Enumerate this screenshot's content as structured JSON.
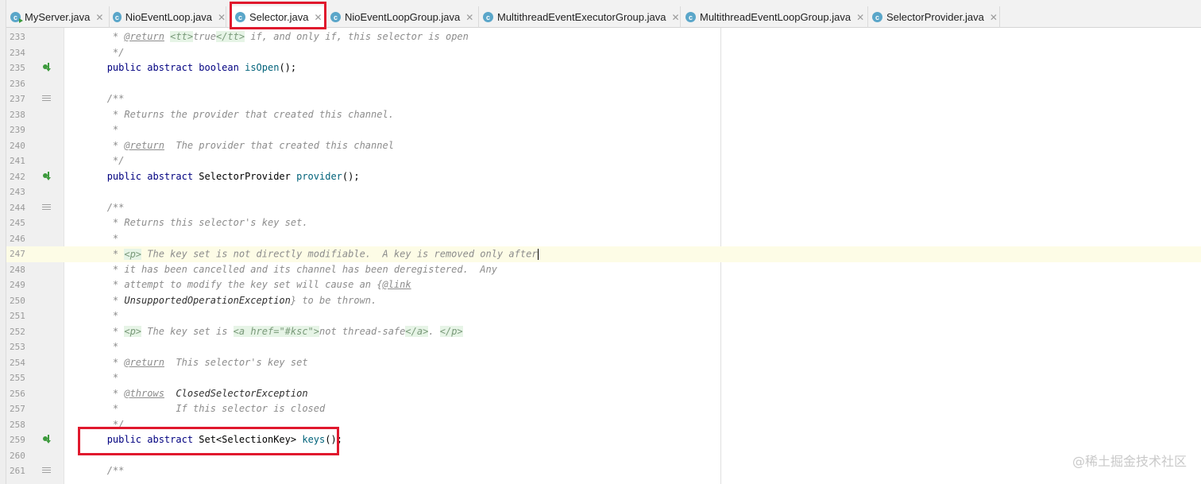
{
  "tabs": [
    {
      "label": "MyServer.java",
      "icon": "class-icon-runnable",
      "active": false
    },
    {
      "label": "NioEventLoop.java",
      "icon": "class-icon",
      "active": false
    },
    {
      "label": "Selector.java",
      "icon": "class-icon",
      "active": true
    },
    {
      "label": "NioEventLoopGroup.java",
      "icon": "class-icon",
      "active": false
    },
    {
      "label": "MultithreadEventExecutorGroup.java",
      "icon": "class-icon",
      "active": false
    },
    {
      "label": "MultithreadEventLoopGroup.java",
      "icon": "class-icon",
      "active": false
    },
    {
      "label": "SelectorProvider.java",
      "icon": "class-icon",
      "active": false
    }
  ],
  "tab_close_glyph": "✕",
  "editor": {
    "current_line": "247",
    "lines": [
      {
        "num": "233",
        "marker": "",
        "html": "    <span class=\"cm\">* <span class=\"tag\">@return</span> <span class=\"ht\">&lt;tt&gt;</span>true<span class=\"ht\">&lt;/tt&gt;</span> if, and only if, this selector is open</span>"
      },
      {
        "num": "234",
        "marker": "",
        "html": "    <span class=\"cm\">*/</span>"
      },
      {
        "num": "235",
        "marker": "impl",
        "html": "   <span class=\"kw\">public abstract boolean</span> <span class=\"m\">isOpen</span>();"
      },
      {
        "num": "236",
        "marker": "",
        "html": ""
      },
      {
        "num": "237",
        "marker": "doc",
        "html": "   <span class=\"cm\">/**</span>"
      },
      {
        "num": "238",
        "marker": "",
        "html": "    <span class=\"cm\">* Returns the provider that created this channel.</span>"
      },
      {
        "num": "239",
        "marker": "",
        "html": "    <span class=\"cm\">*</span>"
      },
      {
        "num": "240",
        "marker": "",
        "html": "    <span class=\"cm\">* <span class=\"tag\">@return</span>  The provider that created this channel</span>"
      },
      {
        "num": "241",
        "marker": "",
        "html": "    <span class=\"cm\">*/</span>"
      },
      {
        "num": "242",
        "marker": "impl",
        "html": "   <span class=\"kw\">public abstract</span> SelectorProvider <span class=\"m\">provider</span>();"
      },
      {
        "num": "243",
        "marker": "",
        "html": ""
      },
      {
        "num": "244",
        "marker": "doc",
        "html": "   <span class=\"cm\">/**</span>"
      },
      {
        "num": "245",
        "marker": "",
        "html": "    <span class=\"cm\">* Returns this selector's key set.</span>"
      },
      {
        "num": "246",
        "marker": "",
        "html": "    <span class=\"cm\">*</span>"
      },
      {
        "num": "247",
        "marker": "",
        "html": "    <span class=\"cm\">* <span class=\"ht\">&lt;p&gt;</span> The key set is not directly modifiable.  A key is removed only after</span><span class=\"caret\"></span>"
      },
      {
        "num": "248",
        "marker": "",
        "html": "    <span class=\"cm\">* it has been cancelled and its channel has been deregistered.  Any</span>"
      },
      {
        "num": "249",
        "marker": "",
        "html": "    <span class=\"cm\">* attempt to modify the key set will cause an {<span class=\"tag\">@link</span></span>"
      },
      {
        "num": "250",
        "marker": "",
        "html": "    <span class=\"cm\">* <span class=\"ref\">UnsupportedOperationException</span>} to be thrown.</span>"
      },
      {
        "num": "251",
        "marker": "",
        "html": "    <span class=\"cm\">*</span>"
      },
      {
        "num": "252",
        "marker": "",
        "html": "    <span class=\"cm\">* <span class=\"ht\">&lt;p&gt;</span> The key set is <span class=\"ht\">&lt;a href=\"#ksc\"&gt;</span>not thread-safe<span class=\"ht\">&lt;/a&gt;</span>. <span class=\"ht\">&lt;/p&gt;</span></span>"
      },
      {
        "num": "253",
        "marker": "",
        "html": "    <span class=\"cm\">*</span>"
      },
      {
        "num": "254",
        "marker": "",
        "html": "    <span class=\"cm\">* <span class=\"tag\">@return</span>  This selector's key set</span>"
      },
      {
        "num": "255",
        "marker": "",
        "html": "    <span class=\"cm\">*</span>"
      },
      {
        "num": "256",
        "marker": "",
        "html": "    <span class=\"cm\">* <span class=\"tag\">@throws</span>  <span class=\"ref\">ClosedSelectorException</span></span>"
      },
      {
        "num": "257",
        "marker": "",
        "html": "    <span class=\"cm\">*          If this selector is closed</span>"
      },
      {
        "num": "258",
        "marker": "",
        "html": "    <span class=\"cm\">*/</span>"
      },
      {
        "num": "259",
        "marker": "impl",
        "html": "   <span class=\"kw\">public abstract</span> Set&lt;SelectionKey&gt; <span class=\"m\">keys</span>();"
      },
      {
        "num": "260",
        "marker": "",
        "html": ""
      },
      {
        "num": "261",
        "marker": "doc",
        "html": "   <span class=\"cm\">/**</span>"
      }
    ]
  },
  "watermark": "@稀土掘金技术社区",
  "colors": {
    "highlight": "#e0182d",
    "keyword": "#000080",
    "method": "#00627a",
    "comment": "#8c8c8c"
  }
}
